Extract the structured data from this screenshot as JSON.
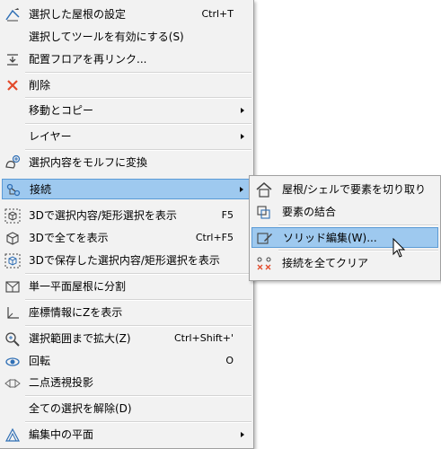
{
  "main_menu": {
    "items": [
      {
        "label": "選択した屋根の設定",
        "shortcut": "Ctrl+T",
        "icon": "roof-settings-icon"
      },
      {
        "label": "選択してツールを有効にする(S)",
        "shortcut": "",
        "icon": ""
      },
      {
        "label": "配置フロアを再リンク...",
        "shortcut": "",
        "icon": "relink-floor-icon"
      },
      {
        "label": "削除",
        "shortcut": "",
        "icon": "delete-icon"
      },
      {
        "label": "移動とコピー",
        "shortcut": "",
        "icon": "",
        "submenu": true
      },
      {
        "label": "レイヤー",
        "shortcut": "",
        "icon": "",
        "submenu": true
      },
      {
        "label": "選択内容をモルフに変換",
        "shortcut": "",
        "icon": "morph-convert-icon"
      },
      {
        "label": "接続",
        "shortcut": "",
        "icon": "connect-icon",
        "submenu": true
      },
      {
        "label": "3Dで選択内容/矩形選択を表示",
        "shortcut": "F5",
        "icon": "show-3d-selection-icon"
      },
      {
        "label": "3Dで全てを表示",
        "shortcut": "Ctrl+F5",
        "icon": "show-3d-all-icon"
      },
      {
        "label": "3Dで保存した選択内容/矩形選択を表示",
        "shortcut": "",
        "icon": "show-3d-saved-selection-icon"
      },
      {
        "label": "単一平面屋根に分割",
        "shortcut": "",
        "icon": "split-roof-icon"
      },
      {
        "label": "座標情報にZを表示",
        "shortcut": "",
        "icon": "coordinate-z-icon"
      },
      {
        "label": "選択範囲まで拡大(Z)",
        "shortcut": "Ctrl+Shift+'",
        "icon": "zoom-selection-icon"
      },
      {
        "label": "回転",
        "shortcut": "O",
        "icon": "orbit-icon"
      },
      {
        "label": "二点透視投影",
        "shortcut": "",
        "icon": "two-point-perspective-icon"
      },
      {
        "label": "全ての選択を解除(D)",
        "shortcut": "",
        "icon": ""
      },
      {
        "label": "編集中の平面",
        "shortcut": "",
        "icon": "editing-plane-icon",
        "submenu": true
      }
    ]
  },
  "sub_menu": {
    "items": [
      {
        "label": "屋根/シェルで要素を切り取り",
        "icon": "trim-roof-icon"
      },
      {
        "label": "要素の結合",
        "icon": "merge-elements-icon"
      },
      {
        "label": "ソリッド編集(W)...",
        "icon": "solid-edit-icon"
      },
      {
        "label": "接続を全てクリア",
        "icon": "clear-connections-icon"
      }
    ]
  },
  "colors": {
    "menu_background": "#f2f2f2",
    "highlight_background": "#9ec9ef",
    "highlight_border": "#5b9bd6",
    "delete_icon": "#e34a2a",
    "icon_blue": "#2f6fb5"
  }
}
